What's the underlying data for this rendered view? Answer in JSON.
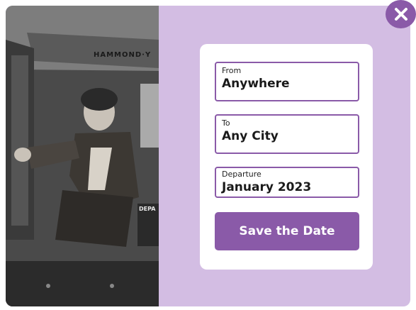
{
  "colors": {
    "panel_bg": "#d3bde3",
    "accent": "#8a5aa8",
    "card_bg": "#ffffff"
  },
  "photo": {
    "description_icon": "photo-icon",
    "plane_text": "HAMMOND·Y",
    "badge_text": "DEPA"
  },
  "form": {
    "from": {
      "label": "From",
      "value": "Anywhere"
    },
    "to": {
      "label": "To",
      "value": "Any City"
    },
    "departure": {
      "label": "Departure",
      "value": "January 2023"
    },
    "save_label": "Save the Date"
  },
  "close": {
    "icon": "close-icon"
  }
}
